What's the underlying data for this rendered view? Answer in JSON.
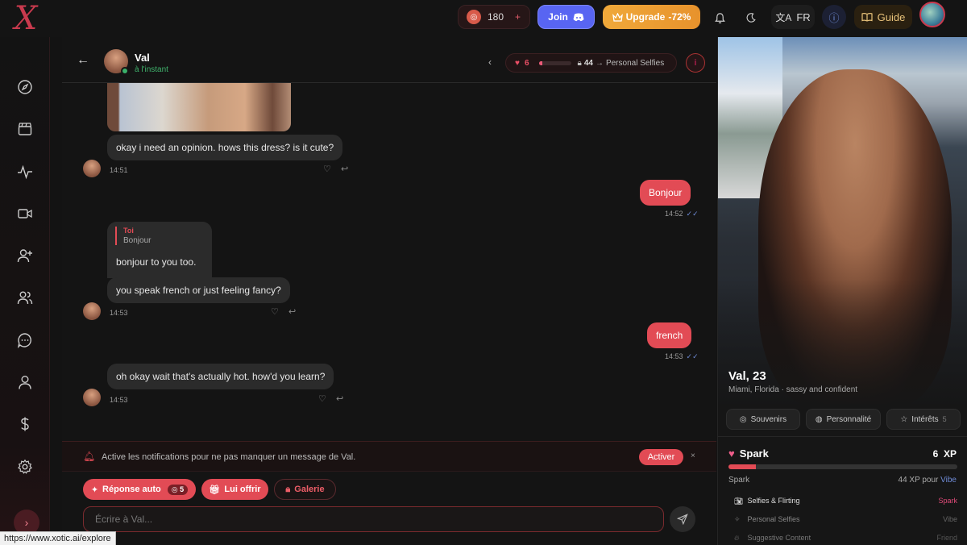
{
  "topbar": {
    "logo": "X",
    "credits": "180",
    "credits_plus": "+",
    "join_label": "Join",
    "upgrade_label": "Upgrade",
    "upgrade_discount": "-72%",
    "lang": "FR",
    "guide_label": "Guide"
  },
  "chat": {
    "contact_name": "Val",
    "contact_status": "à l'instant",
    "level_count": "6",
    "level_fraction": 0.1,
    "xp_needed": "44",
    "xp_arrow": "→",
    "next_unlock": "Personal Selfies",
    "messages": [
      {
        "text": "okay i need an opinion. hows this dress? is it cute?",
        "time": "14:51"
      },
      {
        "text": "Bonjour",
        "time": "14:52"
      },
      {
        "quote_author": "Toi",
        "quote_text": "Bonjour",
        "text": "bonjour to you too."
      },
      {
        "text": "you speak french or just feeling fancy?",
        "time": "14:53"
      },
      {
        "text": "french",
        "time": "14:53"
      },
      {
        "text": "oh okay wait that's actually hot. how'd you learn?",
        "time": "14:53"
      }
    ],
    "notify_text": "Active les notifications pour ne pas manquer un message de Val.",
    "notify_button": "Activer",
    "notify_close": "×",
    "auto_reply_label": "Réponse auto",
    "auto_reply_cost": "5",
    "offer_label": "Lui offrir",
    "gallery_label": "Galerie",
    "input_placeholder": "Écrire à Val...",
    "status_url": "https://www.xotic.ai/explore"
  },
  "profile": {
    "name": "Val, 23",
    "desc": "Miami, Florida · sassy and confident",
    "tabs": [
      {
        "label": "Souvenirs"
      },
      {
        "label": "Personnalité"
      },
      {
        "label": "Intérêts",
        "count": "5"
      }
    ],
    "spark_title": "Spark",
    "spark_level": "6",
    "spark_xp_unit": "XP",
    "spark_fraction": 0.12,
    "spark_label": "Spark",
    "spark_need": "44 XP pour",
    "spark_next": "Vibe",
    "unlocks": [
      {
        "name": "Selfies & Flirting",
        "tier": "Spark",
        "color": "#e24b7a"
      },
      {
        "name": "Personal Selfies",
        "tier": "Vibe",
        "color": "#666666"
      },
      {
        "name": "Suggestive Content",
        "tier": "Friend",
        "color": "#555555"
      }
    ]
  }
}
